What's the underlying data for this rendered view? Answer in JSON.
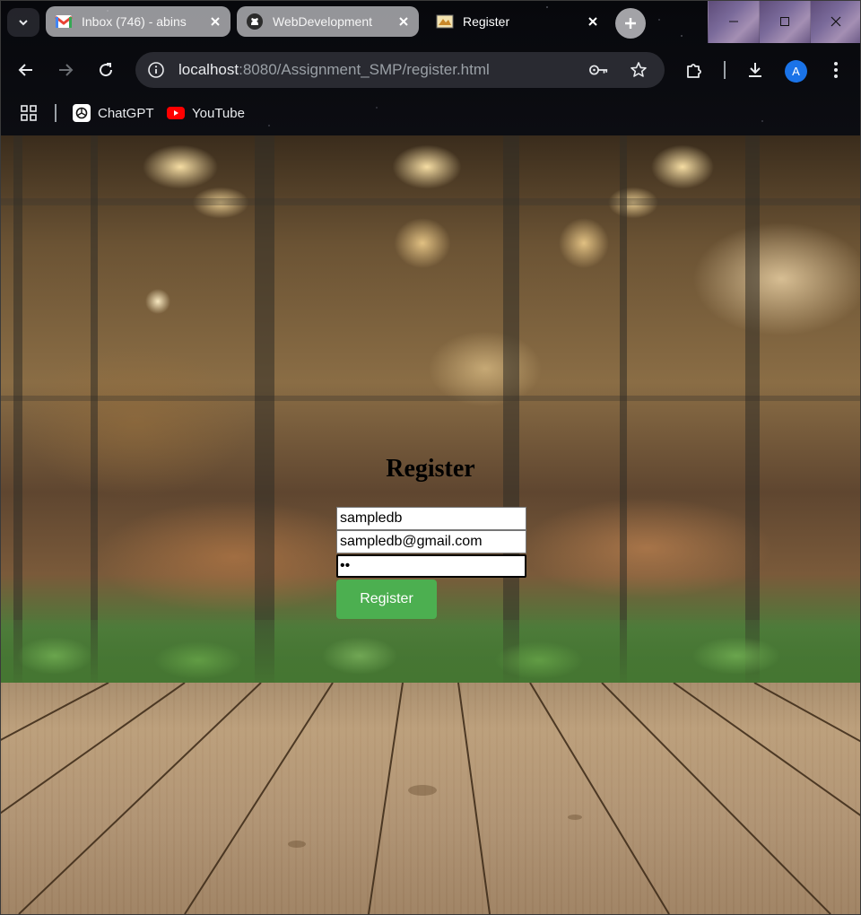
{
  "browser": {
    "tabs": [
      {
        "title": "Inbox (746) - abins",
        "favicon": "gmail-icon",
        "active": false
      },
      {
        "title": "WebDevelopment",
        "favicon": "github-icon",
        "active": false
      },
      {
        "title": "Register",
        "favicon": "page-favicon-icon",
        "active": true
      }
    ],
    "address": {
      "host": "localhost",
      "rest": ":8080/Assignment_SMP/register.html"
    },
    "profile_initial": "A",
    "bookmarks": [
      {
        "label": "ChatGPT",
        "icon": "chatgpt-icon"
      },
      {
        "label": "YouTube",
        "icon": "youtube-icon"
      }
    ]
  },
  "page": {
    "title": "Register",
    "username_value": "sampledb",
    "email_value": "sampledb@gmail.com",
    "password_value": "12",
    "button_label": "Register"
  },
  "colors": {
    "button_bg": "#4caf50",
    "accent": "#1a73e8"
  }
}
